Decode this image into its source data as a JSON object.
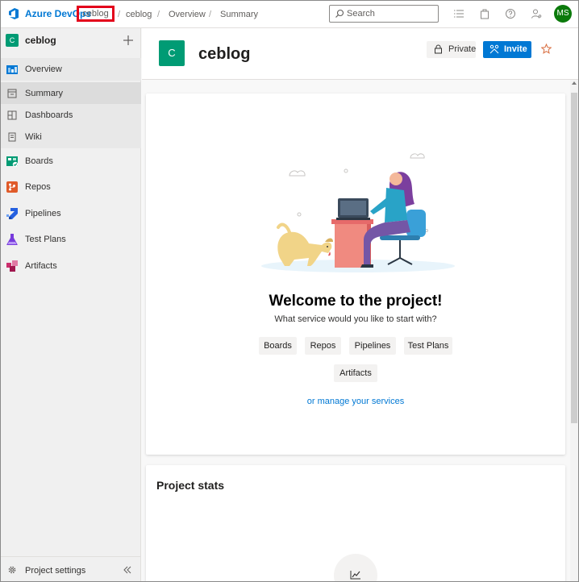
{
  "topbar": {
    "brand": "Azure DevOps",
    "org": "ceblog",
    "breadcrumbs": [
      "ceblog",
      "Overview",
      "Summary"
    ],
    "separator": "/",
    "search_placeholder": "Search",
    "avatar_initials": "MS"
  },
  "sidebar": {
    "project_initial": "C",
    "project_name": "ceblog",
    "items": [
      {
        "label": "Overview",
        "icon": "overview-icon"
      },
      {
        "label": "Summary",
        "icon": "summary-icon"
      },
      {
        "label": "Dashboards",
        "icon": "dashboards-icon"
      },
      {
        "label": "Wiki",
        "icon": "wiki-icon"
      },
      {
        "label": "Boards",
        "icon": "boards-icon"
      },
      {
        "label": "Repos",
        "icon": "repos-icon"
      },
      {
        "label": "Pipelines",
        "icon": "pipelines-icon"
      },
      {
        "label": "Test Plans",
        "icon": "test-plans-icon"
      },
      {
        "label": "Artifacts",
        "icon": "artifacts-icon"
      }
    ],
    "settings_label": "Project settings"
  },
  "header": {
    "project_initial": "C",
    "project_name": "ceblog",
    "private_label": "Private",
    "invite_label": "Invite"
  },
  "welcome": {
    "title": "Welcome to the project!",
    "subtitle": "What service would you like to start with?",
    "services": [
      "Boards",
      "Repos",
      "Pipelines",
      "Test Plans",
      "Artifacts"
    ],
    "manage_link": "or manage your services"
  },
  "stats": {
    "title": "Project stats"
  },
  "colors": {
    "accent": "#0078d4",
    "project_badge": "#009b74",
    "avatar": "#0b7a0b",
    "highlight": "#e3001b"
  }
}
